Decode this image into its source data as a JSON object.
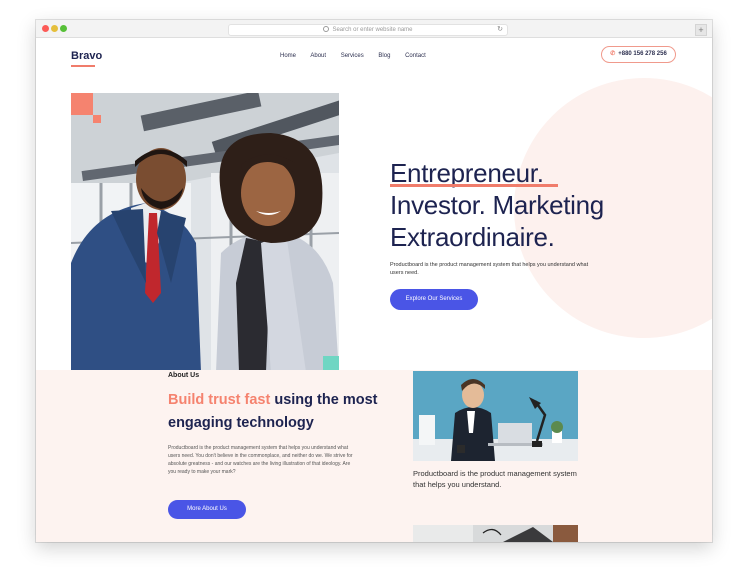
{
  "browser": {
    "url_placeholder": "Search or enter website name",
    "new_tab": "+"
  },
  "header": {
    "logo": "Bravo",
    "nav": [
      "Home",
      "About",
      "Services",
      "Blog",
      "Contact"
    ],
    "phone": "+880 156 278 256"
  },
  "hero": {
    "title_line1": "Entrepreneur.",
    "title_line2": "Investor. Marketing",
    "title_line3": "Extraordinaire.",
    "description": "Productboard is the product management system that helps you understand what users need.",
    "button": "Explore Our Services"
  },
  "about": {
    "label": "About Us",
    "title_highlight": "Build trust fast",
    "title_rest": " using the most engaging technology",
    "description": "Productboard is the product management system that helps you understand what users need. You don't believe in the commonplace, and neither do we. We strive for absolute greatness - and our watches are the living illustration of that ideology. Are you ready to make your mark?",
    "button": "More About Us",
    "card_caption": "Productboard is the product management system that helps you understand."
  },
  "colors": {
    "accent": "#f07c6b",
    "primary": "#4a55e6",
    "heading": "#1d2350",
    "soft_bg": "#fdf3f0"
  }
}
